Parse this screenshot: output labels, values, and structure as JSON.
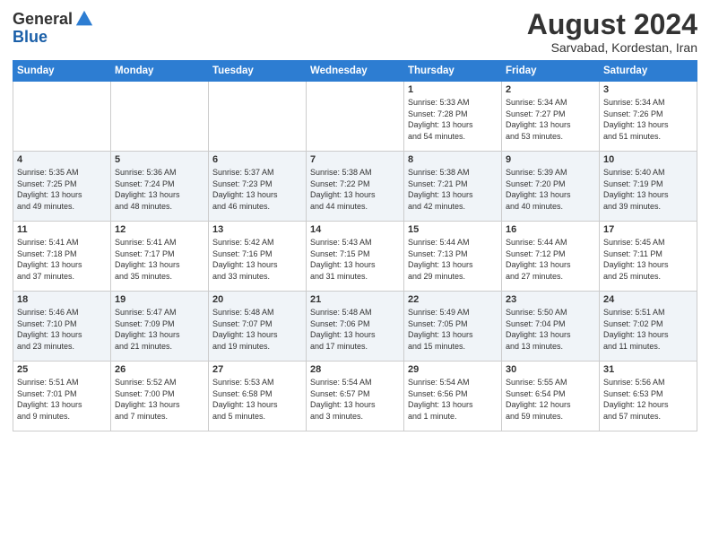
{
  "header": {
    "logo_general": "General",
    "logo_blue": "Blue",
    "title": "August 2024",
    "subtitle": "Sarvabad, Kordestan, Iran"
  },
  "weekdays": [
    "Sunday",
    "Monday",
    "Tuesday",
    "Wednesday",
    "Thursday",
    "Friday",
    "Saturday"
  ],
  "weeks": [
    [
      {
        "day": "",
        "info": ""
      },
      {
        "day": "",
        "info": ""
      },
      {
        "day": "",
        "info": ""
      },
      {
        "day": "",
        "info": ""
      },
      {
        "day": "1",
        "info": "Sunrise: 5:33 AM\nSunset: 7:28 PM\nDaylight: 13 hours\nand 54 minutes."
      },
      {
        "day": "2",
        "info": "Sunrise: 5:34 AM\nSunset: 7:27 PM\nDaylight: 13 hours\nand 53 minutes."
      },
      {
        "day": "3",
        "info": "Sunrise: 5:34 AM\nSunset: 7:26 PM\nDaylight: 13 hours\nand 51 minutes."
      }
    ],
    [
      {
        "day": "4",
        "info": "Sunrise: 5:35 AM\nSunset: 7:25 PM\nDaylight: 13 hours\nand 49 minutes."
      },
      {
        "day": "5",
        "info": "Sunrise: 5:36 AM\nSunset: 7:24 PM\nDaylight: 13 hours\nand 48 minutes."
      },
      {
        "day": "6",
        "info": "Sunrise: 5:37 AM\nSunset: 7:23 PM\nDaylight: 13 hours\nand 46 minutes."
      },
      {
        "day": "7",
        "info": "Sunrise: 5:38 AM\nSunset: 7:22 PM\nDaylight: 13 hours\nand 44 minutes."
      },
      {
        "day": "8",
        "info": "Sunrise: 5:38 AM\nSunset: 7:21 PM\nDaylight: 13 hours\nand 42 minutes."
      },
      {
        "day": "9",
        "info": "Sunrise: 5:39 AM\nSunset: 7:20 PM\nDaylight: 13 hours\nand 40 minutes."
      },
      {
        "day": "10",
        "info": "Sunrise: 5:40 AM\nSunset: 7:19 PM\nDaylight: 13 hours\nand 39 minutes."
      }
    ],
    [
      {
        "day": "11",
        "info": "Sunrise: 5:41 AM\nSunset: 7:18 PM\nDaylight: 13 hours\nand 37 minutes."
      },
      {
        "day": "12",
        "info": "Sunrise: 5:41 AM\nSunset: 7:17 PM\nDaylight: 13 hours\nand 35 minutes."
      },
      {
        "day": "13",
        "info": "Sunrise: 5:42 AM\nSunset: 7:16 PM\nDaylight: 13 hours\nand 33 minutes."
      },
      {
        "day": "14",
        "info": "Sunrise: 5:43 AM\nSunset: 7:15 PM\nDaylight: 13 hours\nand 31 minutes."
      },
      {
        "day": "15",
        "info": "Sunrise: 5:44 AM\nSunset: 7:13 PM\nDaylight: 13 hours\nand 29 minutes."
      },
      {
        "day": "16",
        "info": "Sunrise: 5:44 AM\nSunset: 7:12 PM\nDaylight: 13 hours\nand 27 minutes."
      },
      {
        "day": "17",
        "info": "Sunrise: 5:45 AM\nSunset: 7:11 PM\nDaylight: 13 hours\nand 25 minutes."
      }
    ],
    [
      {
        "day": "18",
        "info": "Sunrise: 5:46 AM\nSunset: 7:10 PM\nDaylight: 13 hours\nand 23 minutes."
      },
      {
        "day": "19",
        "info": "Sunrise: 5:47 AM\nSunset: 7:09 PM\nDaylight: 13 hours\nand 21 minutes."
      },
      {
        "day": "20",
        "info": "Sunrise: 5:48 AM\nSunset: 7:07 PM\nDaylight: 13 hours\nand 19 minutes."
      },
      {
        "day": "21",
        "info": "Sunrise: 5:48 AM\nSunset: 7:06 PM\nDaylight: 13 hours\nand 17 minutes."
      },
      {
        "day": "22",
        "info": "Sunrise: 5:49 AM\nSunset: 7:05 PM\nDaylight: 13 hours\nand 15 minutes."
      },
      {
        "day": "23",
        "info": "Sunrise: 5:50 AM\nSunset: 7:04 PM\nDaylight: 13 hours\nand 13 minutes."
      },
      {
        "day": "24",
        "info": "Sunrise: 5:51 AM\nSunset: 7:02 PM\nDaylight: 13 hours\nand 11 minutes."
      }
    ],
    [
      {
        "day": "25",
        "info": "Sunrise: 5:51 AM\nSunset: 7:01 PM\nDaylight: 13 hours\nand 9 minutes."
      },
      {
        "day": "26",
        "info": "Sunrise: 5:52 AM\nSunset: 7:00 PM\nDaylight: 13 hours\nand 7 minutes."
      },
      {
        "day": "27",
        "info": "Sunrise: 5:53 AM\nSunset: 6:58 PM\nDaylight: 13 hours\nand 5 minutes."
      },
      {
        "day": "28",
        "info": "Sunrise: 5:54 AM\nSunset: 6:57 PM\nDaylight: 13 hours\nand 3 minutes."
      },
      {
        "day": "29",
        "info": "Sunrise: 5:54 AM\nSunset: 6:56 PM\nDaylight: 13 hours\nand 1 minute."
      },
      {
        "day": "30",
        "info": "Sunrise: 5:55 AM\nSunset: 6:54 PM\nDaylight: 12 hours\nand 59 minutes."
      },
      {
        "day": "31",
        "info": "Sunrise: 5:56 AM\nSunset: 6:53 PM\nDaylight: 12 hours\nand 57 minutes."
      }
    ]
  ]
}
